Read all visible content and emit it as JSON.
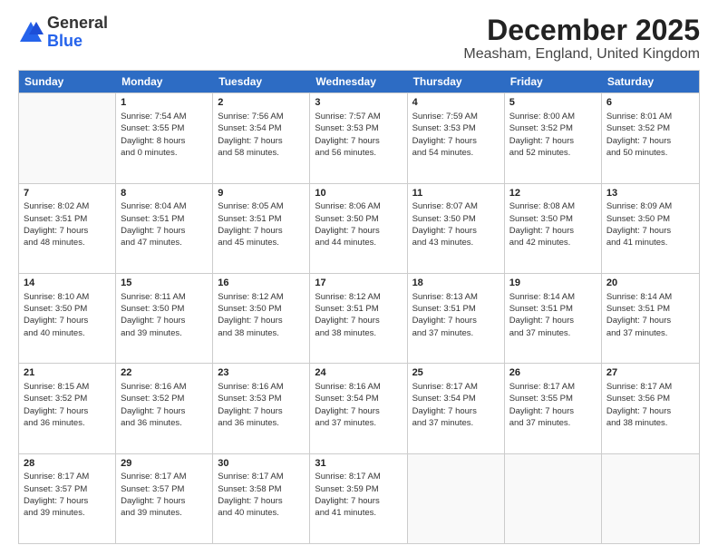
{
  "header": {
    "logo_general": "General",
    "logo_blue": "Blue",
    "title": "December 2025",
    "subtitle": "Measham, England, United Kingdom"
  },
  "days_of_week": [
    "Sunday",
    "Monday",
    "Tuesday",
    "Wednesday",
    "Thursday",
    "Friday",
    "Saturday"
  ],
  "weeks": [
    [
      {
        "day": "",
        "info": ""
      },
      {
        "day": "1",
        "info": "Sunrise: 7:54 AM\nSunset: 3:55 PM\nDaylight: 8 hours\nand 0 minutes."
      },
      {
        "day": "2",
        "info": "Sunrise: 7:56 AM\nSunset: 3:54 PM\nDaylight: 7 hours\nand 58 minutes."
      },
      {
        "day": "3",
        "info": "Sunrise: 7:57 AM\nSunset: 3:53 PM\nDaylight: 7 hours\nand 56 minutes."
      },
      {
        "day": "4",
        "info": "Sunrise: 7:59 AM\nSunset: 3:53 PM\nDaylight: 7 hours\nand 54 minutes."
      },
      {
        "day": "5",
        "info": "Sunrise: 8:00 AM\nSunset: 3:52 PM\nDaylight: 7 hours\nand 52 minutes."
      },
      {
        "day": "6",
        "info": "Sunrise: 8:01 AM\nSunset: 3:52 PM\nDaylight: 7 hours\nand 50 minutes."
      }
    ],
    [
      {
        "day": "7",
        "info": "Sunrise: 8:02 AM\nSunset: 3:51 PM\nDaylight: 7 hours\nand 48 minutes."
      },
      {
        "day": "8",
        "info": "Sunrise: 8:04 AM\nSunset: 3:51 PM\nDaylight: 7 hours\nand 47 minutes."
      },
      {
        "day": "9",
        "info": "Sunrise: 8:05 AM\nSunset: 3:51 PM\nDaylight: 7 hours\nand 45 minutes."
      },
      {
        "day": "10",
        "info": "Sunrise: 8:06 AM\nSunset: 3:50 PM\nDaylight: 7 hours\nand 44 minutes."
      },
      {
        "day": "11",
        "info": "Sunrise: 8:07 AM\nSunset: 3:50 PM\nDaylight: 7 hours\nand 43 minutes."
      },
      {
        "day": "12",
        "info": "Sunrise: 8:08 AM\nSunset: 3:50 PM\nDaylight: 7 hours\nand 42 minutes."
      },
      {
        "day": "13",
        "info": "Sunrise: 8:09 AM\nSunset: 3:50 PM\nDaylight: 7 hours\nand 41 minutes."
      }
    ],
    [
      {
        "day": "14",
        "info": "Sunrise: 8:10 AM\nSunset: 3:50 PM\nDaylight: 7 hours\nand 40 minutes."
      },
      {
        "day": "15",
        "info": "Sunrise: 8:11 AM\nSunset: 3:50 PM\nDaylight: 7 hours\nand 39 minutes."
      },
      {
        "day": "16",
        "info": "Sunrise: 8:12 AM\nSunset: 3:50 PM\nDaylight: 7 hours\nand 38 minutes."
      },
      {
        "day": "17",
        "info": "Sunrise: 8:12 AM\nSunset: 3:51 PM\nDaylight: 7 hours\nand 38 minutes."
      },
      {
        "day": "18",
        "info": "Sunrise: 8:13 AM\nSunset: 3:51 PM\nDaylight: 7 hours\nand 37 minutes."
      },
      {
        "day": "19",
        "info": "Sunrise: 8:14 AM\nSunset: 3:51 PM\nDaylight: 7 hours\nand 37 minutes."
      },
      {
        "day": "20",
        "info": "Sunrise: 8:14 AM\nSunset: 3:51 PM\nDaylight: 7 hours\nand 37 minutes."
      }
    ],
    [
      {
        "day": "21",
        "info": "Sunrise: 8:15 AM\nSunset: 3:52 PM\nDaylight: 7 hours\nand 36 minutes."
      },
      {
        "day": "22",
        "info": "Sunrise: 8:16 AM\nSunset: 3:52 PM\nDaylight: 7 hours\nand 36 minutes."
      },
      {
        "day": "23",
        "info": "Sunrise: 8:16 AM\nSunset: 3:53 PM\nDaylight: 7 hours\nand 36 minutes."
      },
      {
        "day": "24",
        "info": "Sunrise: 8:16 AM\nSunset: 3:54 PM\nDaylight: 7 hours\nand 37 minutes."
      },
      {
        "day": "25",
        "info": "Sunrise: 8:17 AM\nSunset: 3:54 PM\nDaylight: 7 hours\nand 37 minutes."
      },
      {
        "day": "26",
        "info": "Sunrise: 8:17 AM\nSunset: 3:55 PM\nDaylight: 7 hours\nand 37 minutes."
      },
      {
        "day": "27",
        "info": "Sunrise: 8:17 AM\nSunset: 3:56 PM\nDaylight: 7 hours\nand 38 minutes."
      }
    ],
    [
      {
        "day": "28",
        "info": "Sunrise: 8:17 AM\nSunset: 3:57 PM\nDaylight: 7 hours\nand 39 minutes."
      },
      {
        "day": "29",
        "info": "Sunrise: 8:17 AM\nSunset: 3:57 PM\nDaylight: 7 hours\nand 39 minutes."
      },
      {
        "day": "30",
        "info": "Sunrise: 8:17 AM\nSunset: 3:58 PM\nDaylight: 7 hours\nand 40 minutes."
      },
      {
        "day": "31",
        "info": "Sunrise: 8:17 AM\nSunset: 3:59 PM\nDaylight: 7 hours\nand 41 minutes."
      },
      {
        "day": "",
        "info": ""
      },
      {
        "day": "",
        "info": ""
      },
      {
        "day": "",
        "info": ""
      }
    ]
  ]
}
